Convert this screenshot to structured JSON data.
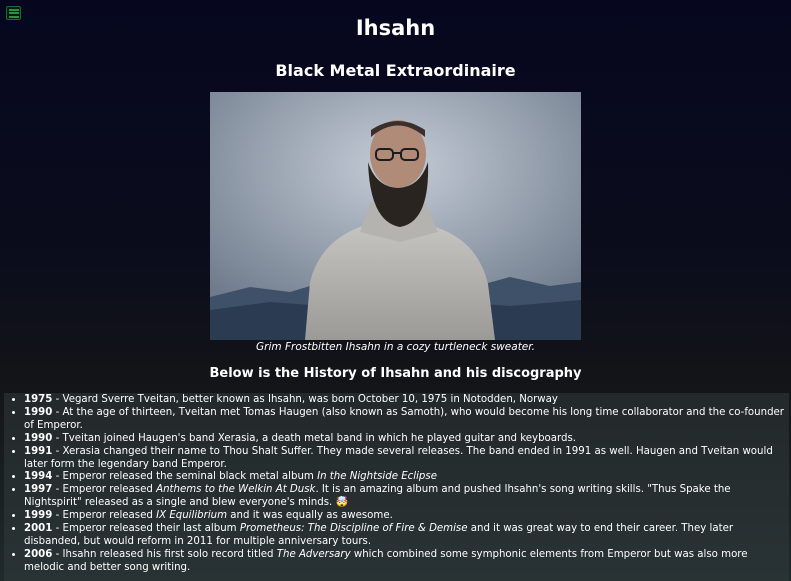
{
  "header": {
    "title": "Ihsahn",
    "subtitle": "Black Metal Extraordinaire"
  },
  "figure": {
    "caption": "Grim Frostbitten Ihsahn in a cozy turtleneck sweater."
  },
  "history": {
    "heading": "Below is the History of Ihsahn and his discography",
    "items": [
      {
        "year": "1975",
        "parts": [
          " - Vegard Sverre Tveitan, better known as Ihsahn, was born October 10, 1975 in Notodden, Norway"
        ]
      },
      {
        "year": "1990",
        "parts": [
          " - At the age of thirteen, Tveitan met Tomas Haugen (also known as Samoth), who would become his long time collaborator and the co-founder of Emperor."
        ]
      },
      {
        "year": "1990",
        "parts": [
          " - Tveitan joined Haugen's band Xerasia, a death metal band in which he played guitar and keyboards."
        ]
      },
      {
        "year": "1991",
        "parts": [
          " - Xerasia changed their name to Thou Shalt Suffer. They made several releases. The band ended in 1991 as well. Haugen and Tveitan would later form the legendary band Emperor."
        ]
      },
      {
        "year": "1994",
        "parts": [
          " - Emperor released the seminal black metal album ",
          "In the Nightside Eclipse"
        ]
      },
      {
        "year": "1997",
        "parts": [
          " - Emperor released ",
          "Anthems to the Welkin At Dusk",
          ". It is an amazing album and pushed Ihsahn's song writing skills. \"Thus Spake the Nightspirit\" released as a single and blew everyone's minds. 🤯"
        ]
      },
      {
        "year": "1999",
        "parts": [
          " - Emperor released ",
          "IX Equilibrium",
          " and it was equally as awesome."
        ]
      },
      {
        "year": "2001",
        "parts": [
          " - Emperor released their last album ",
          "Prometheus: The Discipline of Fire & Demise",
          " and it was great way to end their career. They later disbanded, but would reform in 2011 for multiple anniversary tours."
        ]
      },
      {
        "year": "2006",
        "parts": [
          " - Ihsahn released his first solo record titled ",
          "The Adversary",
          " which combined some symphonic elements from Emperor but was also more melodic and better song writing."
        ]
      }
    ]
  },
  "icons": {
    "menu": "hamburger-menu-icon"
  },
  "colors": {
    "menu_accent": "#1e9a3c",
    "text": "#ffffff"
  }
}
